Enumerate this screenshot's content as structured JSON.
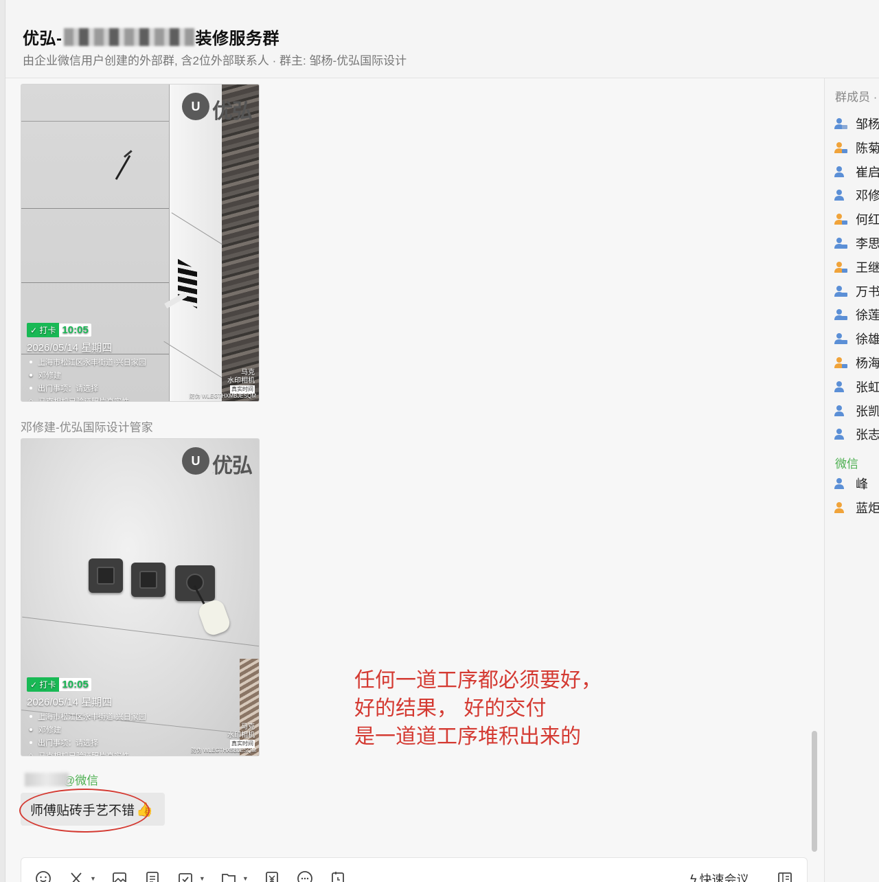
{
  "header": {
    "title_prefix": "优弘-",
    "title_suffix": "装修服务群",
    "subtitle": "由企业微信用户创建的外部群, 含2位外部联系人 · 群主: 邹杨-优弘国际设计"
  },
  "messages": {
    "photo1": {
      "brand": "优弘",
      "checkin": "打卡",
      "time": "10:05",
      "date": "2026/05/14 星期四",
      "address": "上海市松江区永丰街道·兴日家园",
      "person": "邓修建",
      "matter": "出门事项：请选择",
      "verify": "马克相机已验证照片真实性",
      "wm_title": "马克",
      "wm_sub": "水印相机",
      "wm_badge": "真实时间",
      "wm_code": "防伪 WLEGTHXMBJESQM"
    },
    "sender2": "邓修建-优弘国际设计管家",
    "photo2": {
      "brand": "优弘",
      "checkin": "打卡",
      "time": "10:05",
      "date": "2026/05/14 星期四",
      "address": "上海市松江区永丰街道·兴日家园",
      "person": "邓修建",
      "matter": "出门事项：请选择",
      "verify": "马克相机已验证照片真实性",
      "wm_title": "马克",
      "wm_sub": "水印相机",
      "wm_badge": "真实时间",
      "wm_code": "防伪 WLEGTHX5BJESQM"
    },
    "wechat_sender_suffix": "@微信",
    "text_message": "师傅贴砖手艺不错",
    "annotation": [
      "任何一道工序都必须要好，",
      "好的结果， 好的交付",
      "是一道道工序堆积出来的"
    ]
  },
  "composer": {
    "meeting_label": "快速会议"
  },
  "members_panel": {
    "title": "群成员 ·",
    "members": [
      {
        "name": "邹杨",
        "role": "owner"
      },
      {
        "name": "陈菊",
        "role": "admin-orange"
      },
      {
        "name": "崔启",
        "role": "plain"
      },
      {
        "name": "邓修",
        "role": "plain"
      },
      {
        "name": "何红",
        "role": "admin-orange"
      },
      {
        "name": "李思",
        "role": "blue-pc"
      },
      {
        "name": "王继",
        "role": "admin-orange"
      },
      {
        "name": "万书",
        "role": "blue-pc"
      },
      {
        "name": "徐莲",
        "role": "blue-pc"
      },
      {
        "name": "徐雄",
        "role": "blue-pc"
      },
      {
        "name": "杨海",
        "role": "admin-orange"
      },
      {
        "name": "张虹",
        "role": "plain"
      },
      {
        "name": "张凯",
        "role": "plain"
      },
      {
        "name": "张志",
        "role": "plain"
      }
    ],
    "wechat_label": "微信",
    "wechat_members": [
      {
        "name": "峰",
        "role": "plain"
      },
      {
        "name": "蓝炬",
        "role": "orange"
      }
    ]
  },
  "colors": {
    "accent_green": "#19b955",
    "wechat_green": "#4caf50",
    "annotation_red": "#d43a32",
    "member_blue": "#5b8fd6",
    "member_orange": "#f0a33a"
  }
}
